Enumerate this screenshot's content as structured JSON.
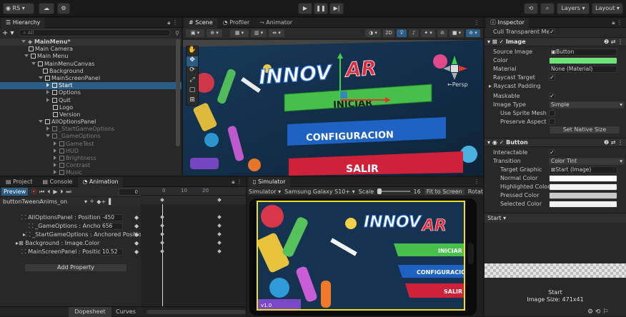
{
  "toolbar": {
    "account": "RS",
    "layers": "Layers",
    "layout": "Layout"
  },
  "hierarchy": {
    "tab": "Hierarchy",
    "search_placeholder": "All",
    "items": [
      {
        "label": "MainMenu*"
      },
      {
        "label": "Main Camera"
      },
      {
        "label": "Main Menu"
      },
      {
        "label": "MainMenuCanvas"
      },
      {
        "label": "Background"
      },
      {
        "label": "MainScreenPanel"
      },
      {
        "label": "Start"
      },
      {
        "label": "Options"
      },
      {
        "label": "Quit"
      },
      {
        "label": "Logo"
      },
      {
        "label": "Version"
      },
      {
        "label": "AllOptionsPanel"
      },
      {
        "label": "_StartGameOptions"
      },
      {
        "label": "_GameOptions"
      },
      {
        "label": "GameTest"
      },
      {
        "label": "HUD"
      },
      {
        "label": "Brightness"
      },
      {
        "label": "Contrast"
      },
      {
        "label": "Music"
      }
    ]
  },
  "scene": {
    "tabs": [
      "Scene",
      "Profiler",
      "Animator"
    ],
    "persp": "←Persp",
    "mode_2d": "2D",
    "logo_a": "INNOV",
    "logo_b": "AR",
    "btn_start": "INICIAR",
    "btn_config": "CONFIGURACION",
    "btn_exit": "SALIR"
  },
  "animation": {
    "tabs": [
      "Project",
      "Console",
      "Animation"
    ],
    "preview": "Preview",
    "frame": "0",
    "clip": "buttonTweenAnims_on",
    "ticks": [
      "0",
      "10",
      "20"
    ],
    "properties": [
      {
        "label": "AllOptionsPanel : Position.z",
        "value": "-450"
      },
      {
        "label": "_GameOptions : Anchore",
        "value": "656"
      },
      {
        "label": "_StartGameOptions : Anchored Position",
        "value": ""
      },
      {
        "label": "Background : Image.Color",
        "value": ""
      },
      {
        "label": "MainScreenPanel : Position",
        "value": "10.52"
      }
    ],
    "add_property": "Add Property",
    "dopesheet": "Dopesheet",
    "curves": "Curves"
  },
  "simulator": {
    "tab": "Simulator",
    "mode": "Simulator ▾",
    "device": "Samsung Galaxy S10+ ▾",
    "scale_label": "Scale",
    "scale_value": "16",
    "fit": "Fit to Screen",
    "rotate": "Rotat",
    "version": "v1.0"
  },
  "inspector": {
    "tab": "Inspector",
    "cull": "Cull Transparent Mes",
    "image_section": "Image",
    "image_rows": [
      {
        "label": "Source Image",
        "value": "Button"
      },
      {
        "label": "Color",
        "value": ""
      },
      {
        "label": "Material",
        "value": "None (Material)"
      },
      {
        "label": "Raycast Target",
        "value": ""
      },
      {
        "label": "Raycast Padding",
        "value": ""
      },
      {
        "label": "Maskable",
        "value": ""
      },
      {
        "label": "Image Type",
        "value": "Simple"
      },
      {
        "label": "Use Sprite Mesh",
        "value": ""
      },
      {
        "label": "Preserve Aspect",
        "value": ""
      }
    ],
    "set_native": "Set Native Size",
    "button_section": "Button",
    "button_rows": [
      {
        "label": "Interactable",
        "value": ""
      },
      {
        "label": "Transition",
        "value": "Color Tint"
      },
      {
        "label": "Target Graphic",
        "value": "Start (Image)"
      },
      {
        "label": "Normal Color",
        "value": ""
      },
      {
        "label": "Highlighted Color",
        "value": ""
      },
      {
        "label": "Pressed Color",
        "value": ""
      },
      {
        "label": "Selected Color",
        "value": ""
      }
    ],
    "footer_label": "Start ▾",
    "preview_name": "Start",
    "preview_size": "Image Size: 471x41"
  },
  "colors": {
    "accent_green": "#6fe27a",
    "selection": "#2c5d87",
    "btn_green": "#46c04b",
    "btn_blue": "#1e63c4",
    "btn_red": "#d0213a",
    "sim_border": "#f0e020"
  }
}
